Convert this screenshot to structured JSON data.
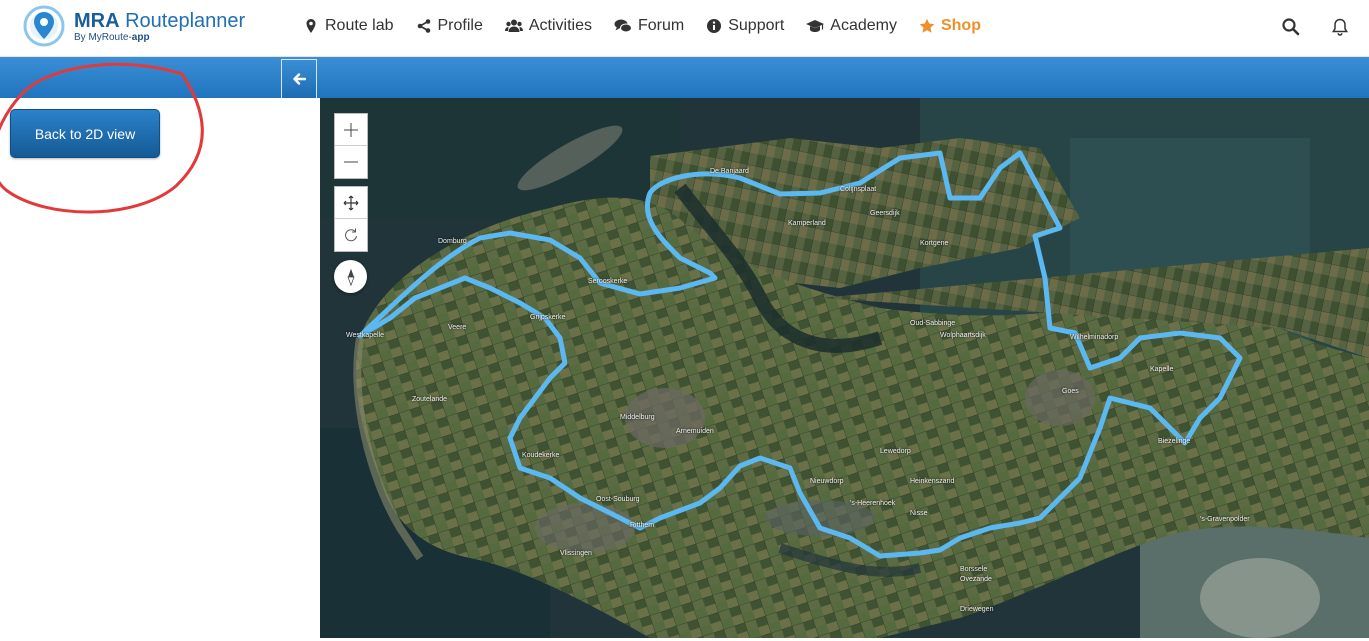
{
  "brand": {
    "title_bold": "MRA",
    "title_rest": " Routeplanner",
    "subtitle_prefix": "By MyRoute-",
    "subtitle_bold": "app"
  },
  "nav": {
    "items": [
      {
        "label": "Route lab",
        "icon": "map-marker-icon"
      },
      {
        "label": "Profile",
        "icon": "share-icon"
      },
      {
        "label": "Activities",
        "icon": "users-icon"
      },
      {
        "label": "Forum",
        "icon": "comments-icon"
      },
      {
        "label": "Support",
        "icon": "info-circle-icon"
      },
      {
        "label": "Academy",
        "icon": "graduation-cap-icon"
      },
      {
        "label": "Shop",
        "icon": "star-icon"
      }
    ],
    "shop_color": "#f0902a"
  },
  "sidebar": {
    "back_label": "Back to 2D view"
  },
  "map": {
    "route_color": "#5bb8f0",
    "places": [
      {
        "name": "De Banjaard"
      },
      {
        "name": "Domburg"
      },
      {
        "name": "Serooskerke"
      },
      {
        "name": "Kamperland"
      },
      {
        "name": "Colijnsplaat"
      },
      {
        "name": "Geersdijk"
      },
      {
        "name": "Kortgene"
      },
      {
        "name": "Veere"
      },
      {
        "name": "Grijpskerke"
      },
      {
        "name": "Westkapelle"
      },
      {
        "name": "Oud-Sabbinge"
      },
      {
        "name": "Wolphaartsdijk"
      },
      {
        "name": "Wilhelminadorp"
      },
      {
        "name": "Kapelle"
      },
      {
        "name": "Middelburg"
      },
      {
        "name": "Arnemuiden"
      },
      {
        "name": "Goes"
      },
      {
        "name": "Nieuwdorp"
      },
      {
        "name": "Heinkenszand"
      },
      {
        "name": "Vlissingen"
      },
      {
        "name": "Oost-Souburg"
      },
      {
        "name": "'s-Heerenhoek"
      },
      {
        "name": "Nisse"
      },
      {
        "name": "Borssele"
      },
      {
        "name": "Ovezande"
      },
      {
        "name": "Driewegen"
      },
      {
        "name": "Lewedorp"
      },
      {
        "name": "Biezelinge"
      },
      {
        "name": "'s-Gravenpolder"
      },
      {
        "name": "Zoutelande"
      },
      {
        "name": "Koudekerke"
      },
      {
        "name": "Ritthem"
      }
    ]
  }
}
